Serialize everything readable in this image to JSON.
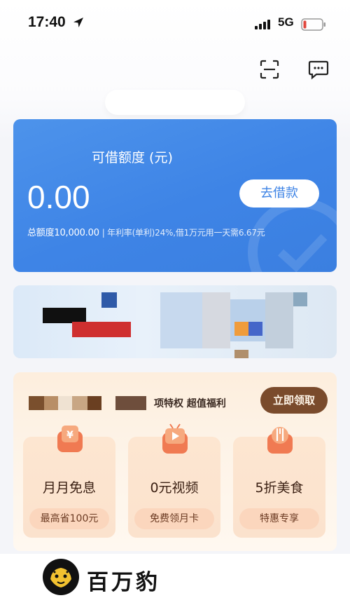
{
  "status_bar": {
    "time": "17:40",
    "network": "5G"
  },
  "header": {
    "scan_icon": "scan-icon",
    "message_icon": "message-icon"
  },
  "credit_card": {
    "title": "可借额度 (元)",
    "amount": "0.00",
    "borrow_label": "去借款",
    "total_label": "总额度10,000.00",
    "rate_text": "年利率(单利)24%,借1万元用一天需6.67元"
  },
  "privilege": {
    "title": "项特权 超值福利",
    "claim_label": "立即领取",
    "items": [
      {
        "title": "月月免息",
        "subtitle": "最高省100元",
        "icon": "coupon-icon"
      },
      {
        "title": "0元视频",
        "subtitle": "免费领月卡",
        "icon": "video-icon"
      },
      {
        "title": "5折美食",
        "subtitle": "特惠专享",
        "icon": "food-icon"
      }
    ]
  },
  "watermark": {
    "brand": "百万豹"
  },
  "colors": {
    "card_blue": "#3e84e6",
    "claim_brown": "#7a4b2c",
    "benefit_bg": "#fde6d1"
  }
}
